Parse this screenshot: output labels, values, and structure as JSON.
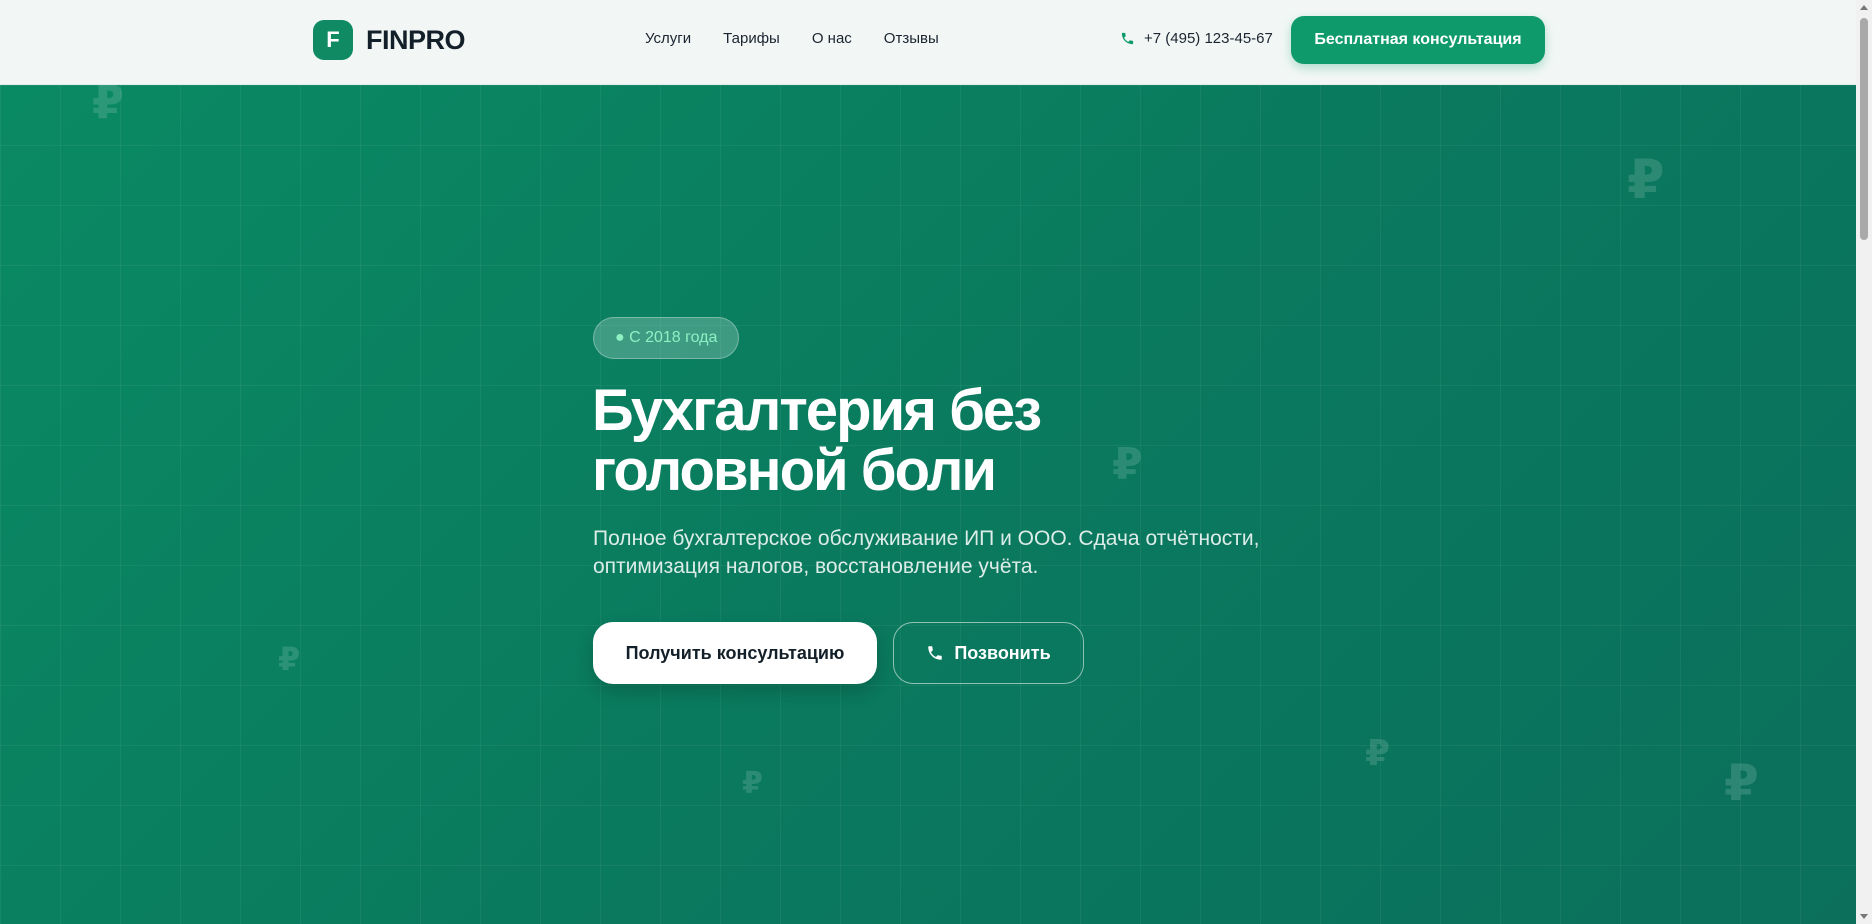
{
  "header": {
    "logo_letter": "F",
    "logo_text": "FINPRO",
    "nav": [
      "Услуги",
      "Тарифы",
      "О нас",
      "Отзывы"
    ],
    "phone": "+7 (495) 123-45-67",
    "cta_label": "Бесплатная консультация"
  },
  "hero": {
    "badge": "● С 2018 года",
    "title_line1": "Бухгалтерия без",
    "title_line2": "головной боли",
    "subtitle_line1": "Полное бухгалтерское обслуживание ИП и ООО. Сдача отчётности,",
    "subtitle_line2": "оптимизация налогов, восстановление учёта.",
    "primary_button": "Получить консультацию",
    "secondary_button": "Позвонить",
    "background_symbol": "₽"
  },
  "colors": {
    "accent": "#0f9a6c",
    "hero_bg": "#0a7d5e",
    "badge_text": "#8ff0c4"
  },
  "icons": {
    "phone": "phone-icon",
    "decor": "ruble-icon"
  }
}
